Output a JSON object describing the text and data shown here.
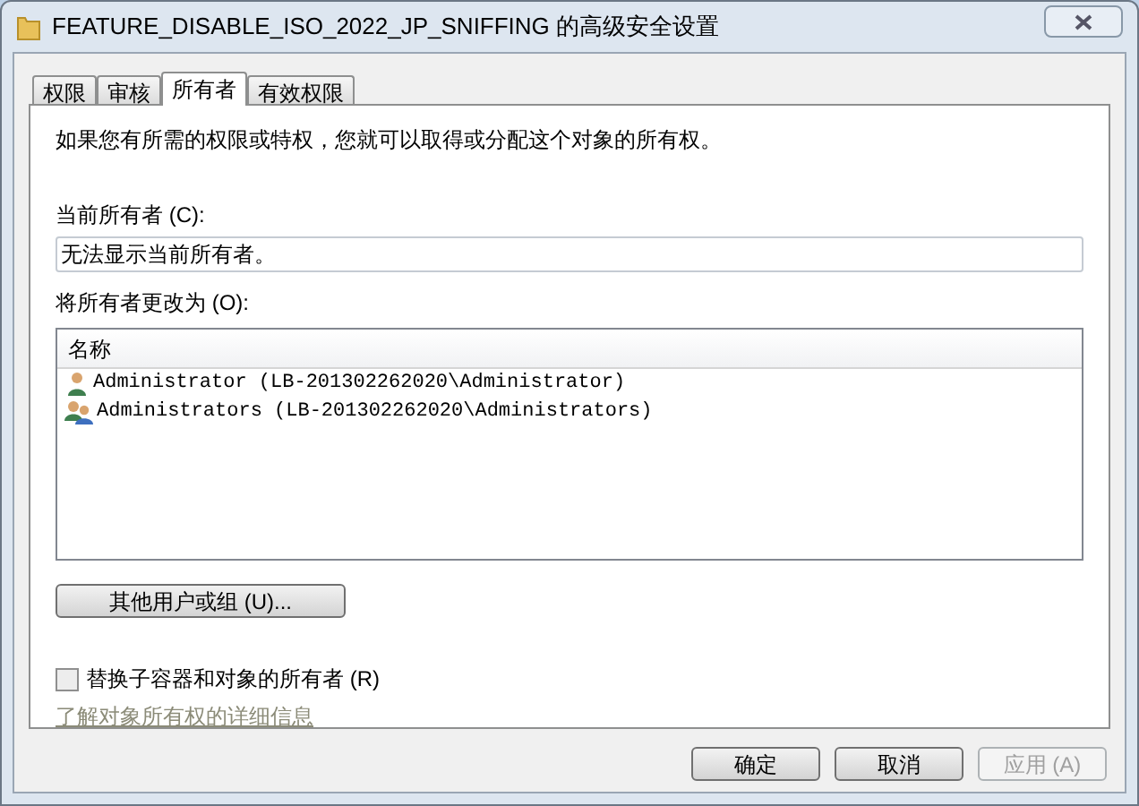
{
  "window": {
    "title": "FEATURE_DISABLE_ISO_2022_JP_SNIFFING 的高级安全设置"
  },
  "tabs": [
    {
      "label": "权限",
      "selected": false
    },
    {
      "label": "审核",
      "selected": false
    },
    {
      "label": "所有者",
      "selected": true
    },
    {
      "label": "有效权限",
      "selected": false
    }
  ],
  "intro": "如果您有所需的权限或特权，您就可以取得或分配这个对象的所有权。",
  "current_owner": {
    "label": "当前所有者 (C):",
    "value": "无法显示当前所有者。"
  },
  "change_owner": {
    "label": "将所有者更改为 (O):",
    "columns": [
      "名称"
    ],
    "rows": [
      {
        "kind": "user",
        "name": "Administrator (LB-201302262020\\Administrator)"
      },
      {
        "kind": "group",
        "name": "Administrators (LB-201302262020\\Administrators)"
      }
    ]
  },
  "other_button": "其他用户或组 (U)...",
  "replace_checkbox": {
    "label": "替换子容器和对象的所有者 (R)",
    "checked": false
  },
  "learn_link": "了解对象所有权的详细信息",
  "buttons": [
    {
      "label": "确定",
      "disabled": false
    },
    {
      "label": "取消",
      "disabled": false
    },
    {
      "label": "应用 (A)",
      "disabled": true
    }
  ]
}
